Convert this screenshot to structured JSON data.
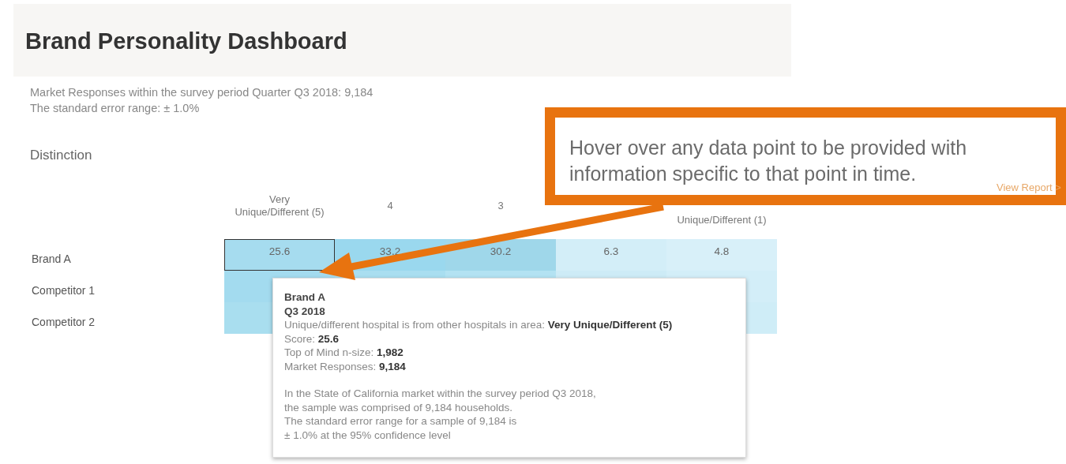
{
  "title": "Brand Personality Dashboard",
  "summary": [
    "Market Responses within the survey period Quarter Q3 2018: 9,184",
    "The standard error range: ± 1.0%"
  ],
  "section": {
    "title": "Distinction",
    "link": "View Report >"
  },
  "table": {
    "columns": [
      {
        "lines": [
          "Very",
          "Unique/Different (5)"
        ]
      },
      {
        "lines": [
          "4"
        ]
      },
      {
        "lines": [
          "3"
        ]
      },
      {},
      {
        "lines": [
          "Unique/Different (1)"
        ]
      }
    ],
    "rows": [
      {
        "label": "Brand A",
        "cells": [
          {
            "value": "25.6",
            "color": "#a6dcef",
            "selected": true
          },
          {
            "value": "33.2",
            "color": "#9ad8ee",
            "selected": false
          },
          {
            "value": "30.2",
            "color": "#9fd7ea",
            "selected": false
          },
          {
            "value": "6.3",
            "color": "#d3eef8",
            "selected": false
          },
          {
            "value": "4.8",
            "color": "#d8f0f9",
            "selected": false
          }
        ]
      },
      {
        "label": "Competitor 1",
        "cells": [
          {
            "color": "#a3dbef",
            "selected": false
          },
          {
            "color": "#a9def0",
            "selected": false
          },
          {
            "color": "#b3e2f2",
            "selected": false
          },
          {
            "color": "#cdebf6",
            "selected": false
          },
          {
            "color": "#d3eef8",
            "selected": false
          }
        ]
      },
      {
        "label": "Competitor 2",
        "cells": [
          {
            "color": "#a9deef",
            "selected": false
          },
          {},
          {},
          {},
          {
            "color": "#cfedf7",
            "selected": false
          }
        ]
      }
    ]
  },
  "tooltip": {
    "heading": [
      "Brand A",
      "Q3 2018"
    ],
    "details": [
      "Unique/different hospital is from other hospitals in area: **Very Unique/Different (5)**",
      "Score: **25.6**",
      "Top of Mind n-size: **1,982**",
      "Market Responses: **9,184**"
    ],
    "note": [
      "In the State of California market within the survey period Q3 2018,",
      "the sample was comprised of 9,184 households.",
      "The standard error range for a sample of 9,184 is",
      "± 1.0% at the 95% confidence level"
    ]
  },
  "callout": {
    "text": "Hover over any data point to be provided with information specific to that point in time."
  }
}
